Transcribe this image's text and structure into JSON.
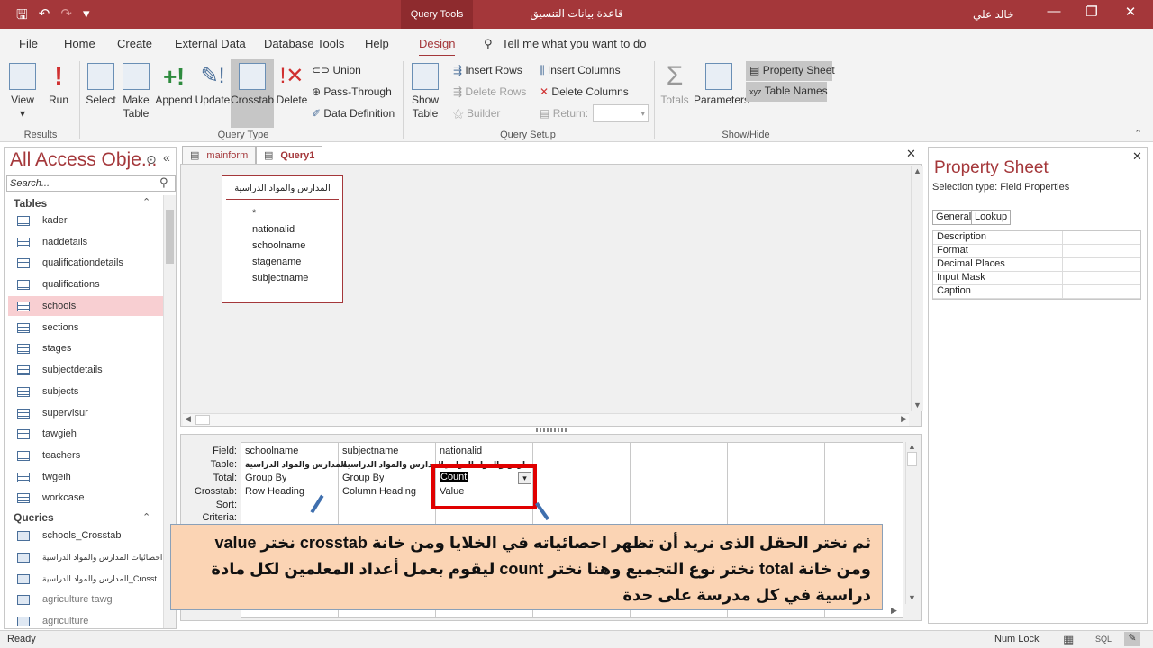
{
  "titlebar": {
    "context_tab": "Query Tools",
    "doc_title": "قاعدة بيانات التنسيق",
    "user": "خالد علي",
    "save_icon": "save-icon",
    "undo_icon": "undo-icon",
    "redo_icon": "redo-icon",
    "minimize": "—",
    "restore": "❐",
    "close": "✕"
  },
  "menu": {
    "file": "File",
    "home": "Home",
    "create": "Create",
    "external": "External Data",
    "dbtools": "Database Tools",
    "help": "Help",
    "design": "Design",
    "tell_me": "Tell me what you want to do"
  },
  "ribbon": {
    "view": "View",
    "run": "Run",
    "results": "Results",
    "select": "Select",
    "make_table_1": "Make",
    "make_table_2": "Table",
    "append": "Append",
    "update": "Update",
    "crosstab": "Crosstab",
    "delete": "Delete",
    "union": "Union",
    "pass_through": "Pass-Through",
    "data_definition": "Data Definition",
    "query_type": "Query Type",
    "show_table_1": "Show",
    "show_table_2": "Table",
    "insert_rows": "Insert Rows",
    "delete_rows": "Delete Rows",
    "builder": "Builder",
    "insert_columns": "Insert Columns",
    "delete_columns": "Delete Columns",
    "return": "Return:",
    "query_setup": "Query Setup",
    "totals": "Totals",
    "parameters": "Parameters",
    "property_sheet": "Property Sheet",
    "table_names": "Table Names",
    "show_hide": "Show/Hide"
  },
  "nav": {
    "title": "All Access Obje...",
    "search_placeholder": "Search...",
    "tables_header": "Tables",
    "tables": [
      "kader",
      "naddetails",
      "qualificationdetails",
      "qualifications",
      "schools",
      "sections",
      "stages",
      "subjectdetails",
      "subjects",
      "supervisur",
      "tawgieh",
      "teachers",
      "twgeih",
      "workcase"
    ],
    "queries_header": "Queries",
    "queries": [
      "schools_Crosstab",
      "احصائيات المدارس والمواد الدراسية",
      "المدارس والمواد الدراسية_Crosst...",
      "agriculture tawg",
      "agriculture"
    ]
  },
  "doctabs": {
    "tab1": "mainform",
    "tab2": "Query1"
  },
  "tablebox": {
    "title": "المدارس والمواد الدراسية",
    "fields": [
      "*",
      "nationalid",
      "schoolname",
      "stagename",
      "subjectname"
    ]
  },
  "grid": {
    "labels": {
      "field": "Field:",
      "table": "Table:",
      "total": "Total:",
      "crosstab": "Crosstab:",
      "sort": "Sort:",
      "criteria": "Criteria:"
    },
    "columns": [
      {
        "field": "schoolname",
        "table": "المدارس والمواد الدراسية",
        "total": "Group By",
        "crosstab": "Row Heading"
      },
      {
        "field": "subjectname",
        "table": "المدارس والمواد الدراسية",
        "total": "Group By",
        "crosstab": "Column Heading"
      },
      {
        "field": "nationalid",
        "table": "المدارس والمواد الدراسية",
        "total": "Count",
        "crosstab": "Value"
      }
    ]
  },
  "props": {
    "title": "Property Sheet",
    "selection": "Selection type:  Field Properties",
    "tab_general": "General",
    "tab_lookup": "Lookup",
    "rows": [
      "Description",
      "Format",
      "Decimal Places",
      "Input Mask",
      "Caption"
    ]
  },
  "callout": {
    "text": "ثم نختر الحقل الذى نريد أن تظهر احصائياته في الخلايا ومن خانة crosstab نختر value ومن خانة total نختر نوع التجميع وهنا نختر count ليقوم بعمل أعداد المعلمين لكل مادة دراسية في كل مدرسة على حدة"
  },
  "status": {
    "ready": "Ready",
    "numlock": "Num Lock",
    "sql": "SQL"
  }
}
